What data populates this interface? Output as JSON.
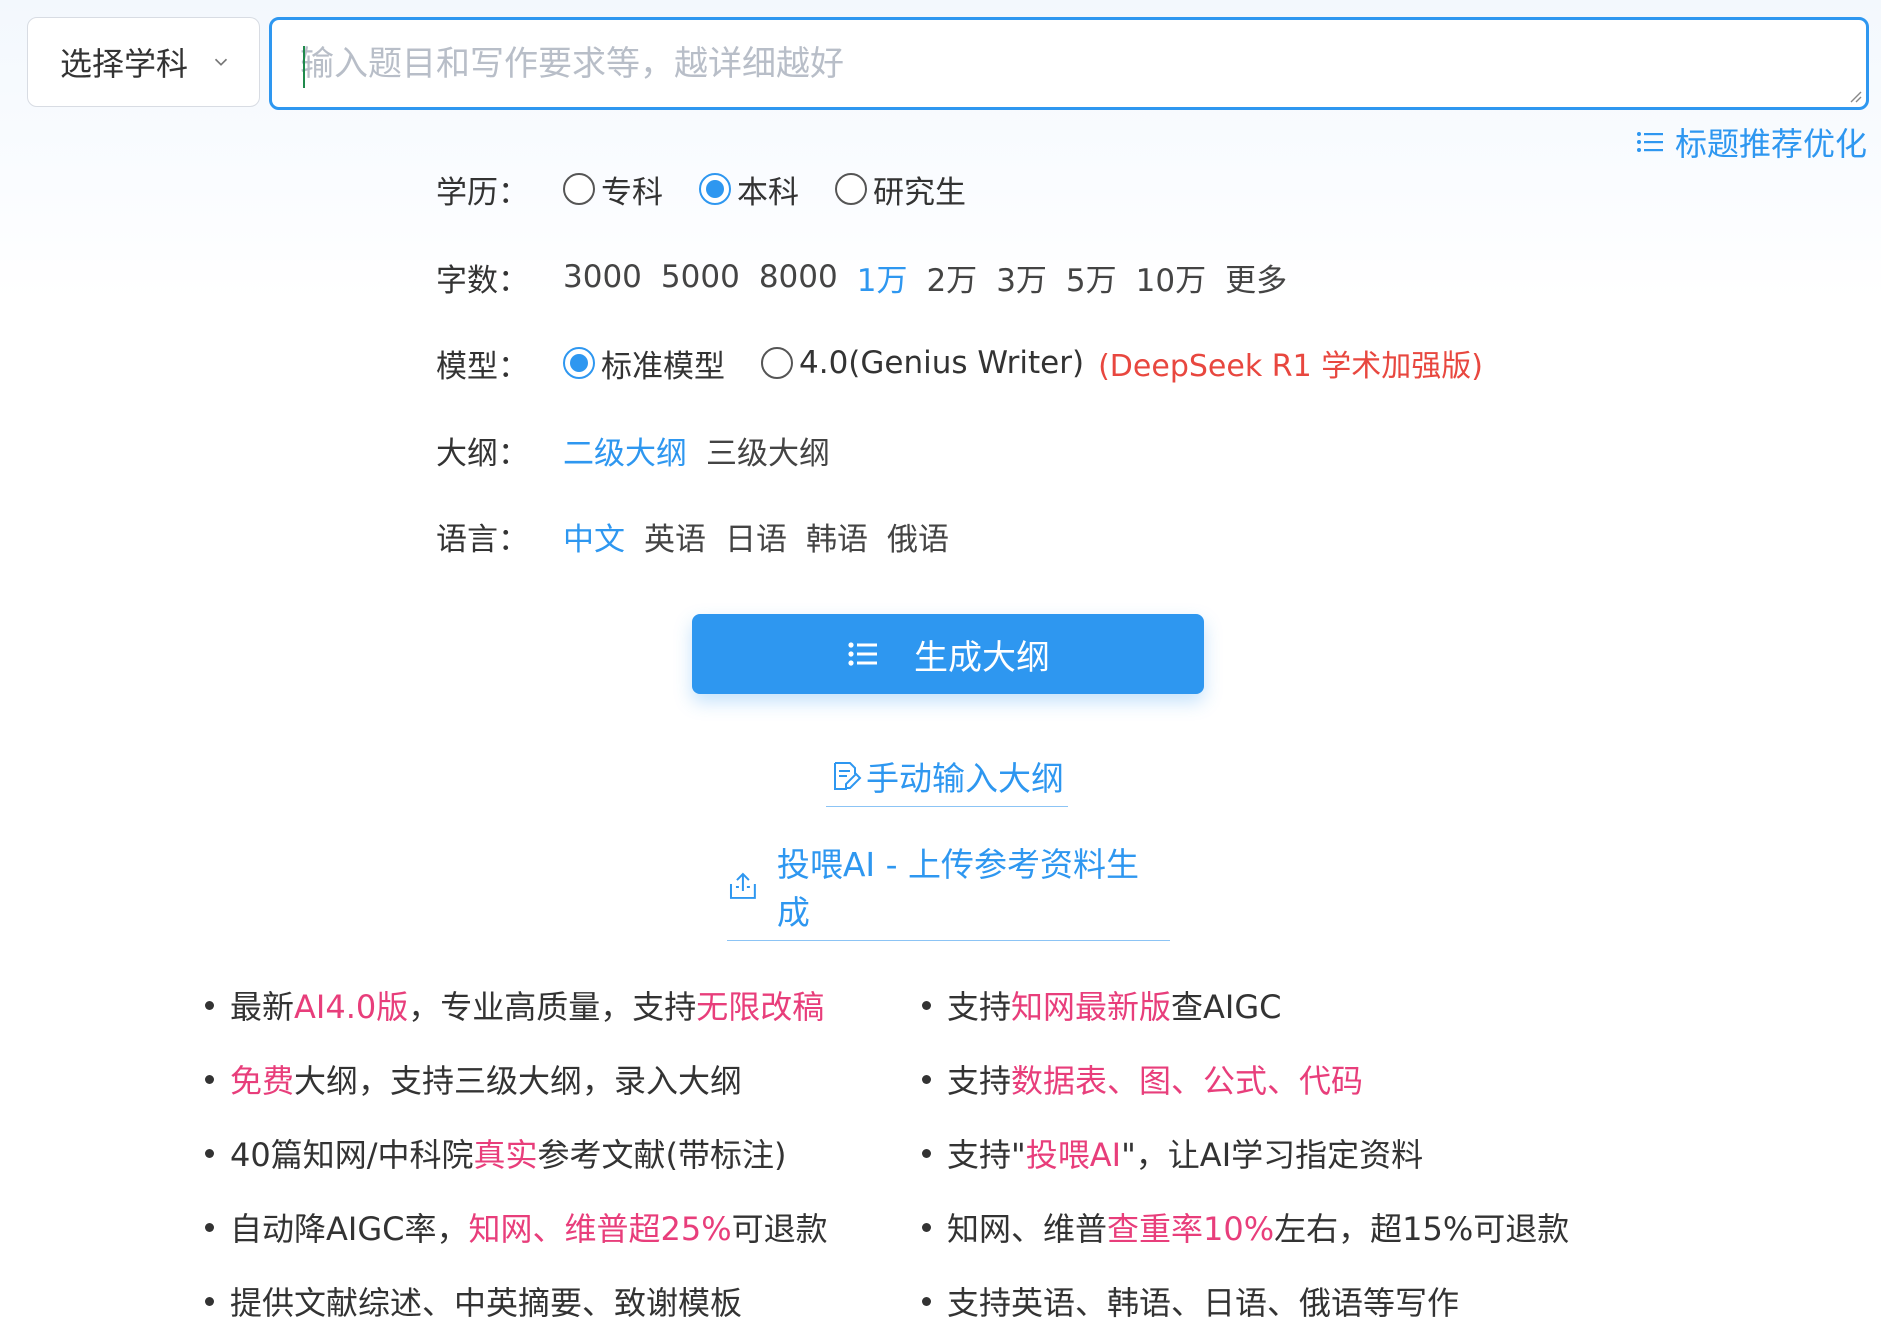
{
  "top": {
    "subject_label": "选择学科",
    "topic_placeholder": "输入题目和写作要求等，越详细越好",
    "title_optimize": "标题推荐优化"
  },
  "education": {
    "label": "学历：",
    "options": [
      "专科",
      "本科",
      "研究生"
    ],
    "selected": "本科"
  },
  "words": {
    "label": "字数：",
    "options": [
      "3000",
      "5000",
      "8000",
      "1万",
      "2万",
      "3万",
      "5万",
      "10万",
      "更多"
    ],
    "selected": "1万"
  },
  "model": {
    "label": "模型：",
    "options": [
      "标准模型",
      "4.0(Genius Writer)"
    ],
    "selected": "标准模型",
    "note": "(DeepSeek R1 学术加强版)"
  },
  "outline": {
    "label": "大纲：",
    "options": [
      "二级大纲",
      "三级大纲"
    ],
    "selected": "二级大纲"
  },
  "language": {
    "label": "语言：",
    "options": [
      "中文",
      "英语",
      "日语",
      "韩语",
      "俄语"
    ],
    "selected": "中文"
  },
  "actions": {
    "generate": "生成大纲",
    "manual": "手动输入大纲",
    "upload": "投喂AI - 上传参考资料生成"
  },
  "features": {
    "left": [
      [
        {
          "t": "最新",
          "h": false
        },
        {
          "t": "AI4.0版",
          "h": true
        },
        {
          "t": "，专业高质量，支持",
          "h": false
        },
        {
          "t": "无限改稿",
          "h": true
        }
      ],
      [
        {
          "t": "免费",
          "h": true
        },
        {
          "t": "大纲，支持三级大纲，录入大纲",
          "h": false
        }
      ],
      [
        {
          "t": "40篇知网/中科院",
          "h": false
        },
        {
          "t": "真实",
          "h": true
        },
        {
          "t": "参考文献(带标注)",
          "h": false
        }
      ],
      [
        {
          "t": "自动降AIGC率，",
          "h": false
        },
        {
          "t": "知网、维普超25%",
          "h": true
        },
        {
          "t": "可退款",
          "h": false
        }
      ],
      [
        {
          "t": "提供文献综述、中英摘要、致谢模板",
          "h": false
        }
      ]
    ],
    "right": [
      [
        {
          "t": "支持",
          "h": false
        },
        {
          "t": "知网最新版",
          "h": true
        },
        {
          "t": "查AIGC",
          "h": false
        }
      ],
      [
        {
          "t": "支持",
          "h": false
        },
        {
          "t": "数据表、图、公式、代码",
          "h": true
        }
      ],
      [
        {
          "t": "支持\"",
          "h": false
        },
        {
          "t": "投喂AI",
          "h": true
        },
        {
          "t": "\"，让AI学习指定资料",
          "h": false
        }
      ],
      [
        {
          "t": "知网、维普",
          "h": false
        },
        {
          "t": "查重率10%",
          "h": true
        },
        {
          "t": "左右，超15%可退款",
          "h": false
        }
      ],
      [
        {
          "t": "支持英语、韩语、日语、俄语等写作",
          "h": false
        }
      ]
    ]
  },
  "colors": {
    "accent": "#2e97f0",
    "highlight": "#e83e7b",
    "note": "#e8473f"
  }
}
